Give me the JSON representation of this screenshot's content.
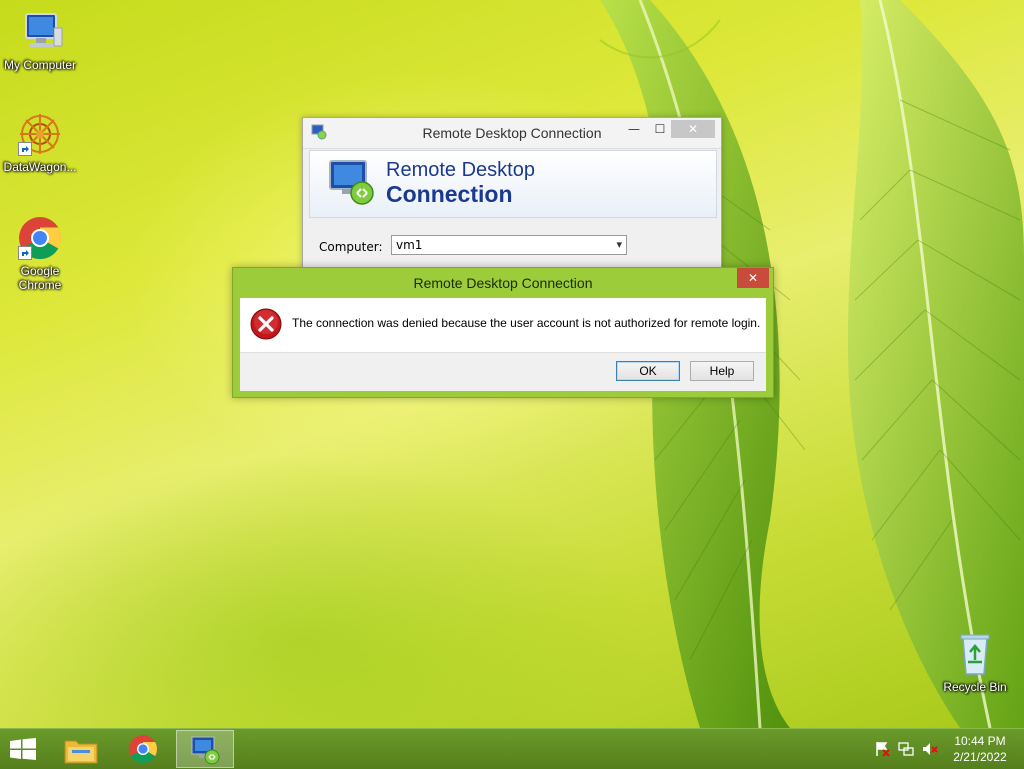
{
  "desktop": {
    "icons": [
      {
        "label": "My Computer",
        "icon": "monitor-icon"
      },
      {
        "label": "DataWagon...",
        "icon": "datawagon-icon"
      },
      {
        "label": "Google Chrome",
        "icon": "chrome-icon"
      },
      {
        "label": "Recycle Bin",
        "icon": "recycle-bin-icon"
      }
    ]
  },
  "rdc_window": {
    "title": "Remote Desktop Connection",
    "banner_line1": "Remote Desktop",
    "banner_line2": "Connection",
    "computer_label": "Computer:",
    "computer_value": "vm1",
    "controls": {
      "minimize": "—",
      "maximize": "☐",
      "close": "✕"
    }
  },
  "error_dialog": {
    "title": "Remote Desktop Connection",
    "message": "The connection was denied because the user account is not authorized for remote login.",
    "ok_label": "OK",
    "help_label": "Help",
    "close": "✕"
  },
  "taskbar": {
    "items": [
      "windows-start-icon",
      "file-explorer-icon",
      "chrome-icon",
      "remote-desktop-icon"
    ],
    "tray": [
      "action-center-flag-icon",
      "network-icon",
      "volume-muted-icon"
    ],
    "time": "10:44 PM",
    "date": "2/21/2022"
  },
  "colors": {
    "dialog_frame": "#9ccc3a",
    "taskbar": "#5f8c24",
    "error_red": "#c4161c",
    "banner_text": "#1a3a8f"
  }
}
